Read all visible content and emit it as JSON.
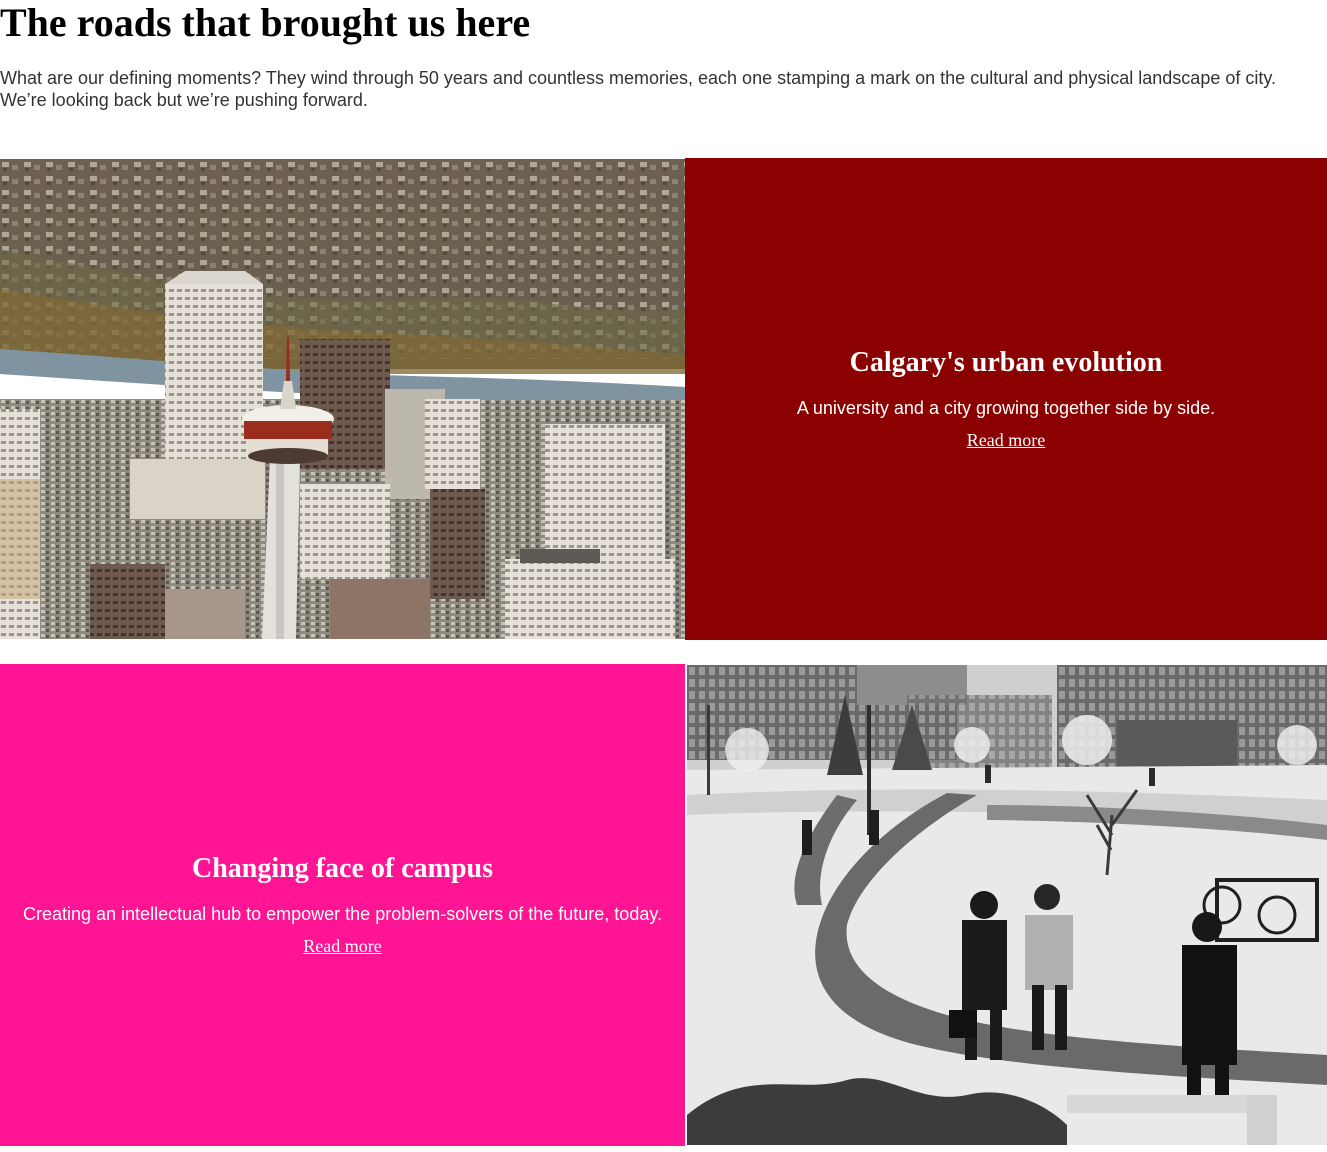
{
  "header": {
    "title": "The roads that brought us here",
    "intro": "What are our defining moments? They wind through 50 years and countless memories, each one stamping a mark on the cultural and physical landscape of city. We’re looking back but we’re pushing forward."
  },
  "stories": [
    {
      "title": "Calgary's urban evolution",
      "description": "A university and a city growing together side by side.",
      "link_label": "Read more",
      "panel_color": "#8b0000",
      "image": "aerial-city-photo"
    },
    {
      "title": "Changing face of campus",
      "description": "Creating an intellectual hub to empower the problem-solvers of the future, today.",
      "link_label": "Read more",
      "panel_color": "#ff1493",
      "image": "winter-campus-photo"
    }
  ]
}
